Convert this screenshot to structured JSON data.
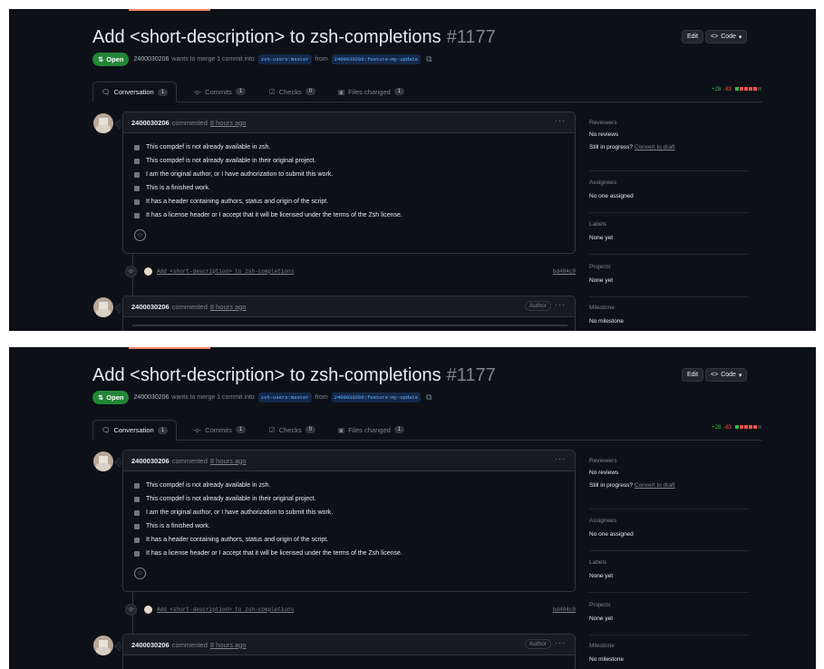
{
  "pr": {
    "title": "Add <short-description> to zsh-completions",
    "number": "#1177",
    "edit_label": "Edit",
    "code_label": "Code",
    "state": "Open",
    "author": "2400030206",
    "merge_text": "wants to merge 1 commit into",
    "base_branch": "zsh-users:master",
    "from_text": "from",
    "head_branch": "2400030206:feature-my-update"
  },
  "tabs": [
    {
      "label": "Conversation",
      "count": "1"
    },
    {
      "label": "Commits",
      "count": "1"
    },
    {
      "label": "Checks",
      "count": "0"
    },
    {
      "label": "Files changed",
      "count": "1"
    }
  ],
  "diffstat": {
    "additions": "+28",
    "deletions": "-83"
  },
  "comment1": {
    "author": "2400030206",
    "action": "commented",
    "time": "8 hours ago",
    "checklist": [
      "This compdef is not already available in zsh.",
      "This compdef is not already available in their original project.",
      "I am the original author, or I have authorization to submit this work.",
      "This is a finished work.",
      "It has a header containing authors, status and origin of the script.",
      "It has a license header or I accept that it will be licensed under the terms of the Zsh license."
    ]
  },
  "commit": {
    "message": "Add <short-description> to zsh-completions",
    "sha": "bd404c0"
  },
  "comment2": {
    "author": "2400030206",
    "action": "commented",
    "time": "8 hours ago",
    "badge": "Author"
  },
  "sidebar": {
    "reviewers_h": "Reviewers",
    "reviewers_v": "No reviews",
    "progress_q": "Still in progress?",
    "progress_link": "Convert to draft",
    "assignees_h": "Assignees",
    "assignees_v": "No one assigned",
    "labels_h": "Labels",
    "labels_v": "None yet",
    "projects_h": "Projects",
    "projects_v": "None yet",
    "milestone_h": "Milestone",
    "milestone_v": "No milestone"
  },
  "colors": {
    "bg": "#0d1117",
    "open_green": "#238636",
    "accent": "#f78166",
    "add": "#3fb950",
    "del": "#f85149"
  }
}
